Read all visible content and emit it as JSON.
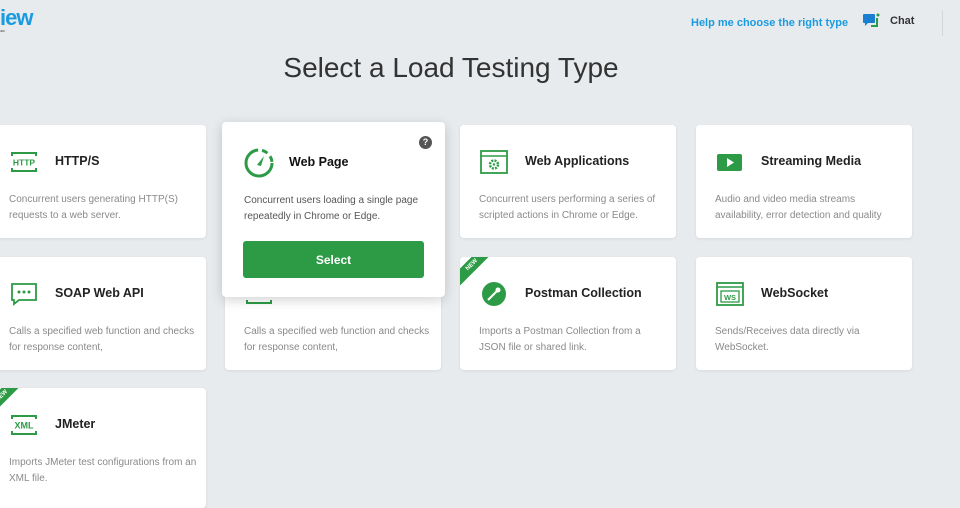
{
  "header": {
    "logo": "iew",
    "logo_sub": "ooo",
    "help_link": "Help me choose the right type",
    "chat_label": "Chat"
  },
  "title": "Select a Load Testing Type",
  "accent": "#2d9b45",
  "link_color": "#1a9be0",
  "cards": [
    {
      "title": "HTTP/S",
      "desc": "Concurrent users generating HTTP(S) requests to a web server.",
      "icon": "http-icon",
      "new": false
    },
    {
      "title": "Web Applications",
      "desc": "Concurrent users performing a series of scripted actions in Chrome or Edge.",
      "icon": "web-app-gear-icon",
      "new": false
    },
    {
      "title": "Streaming Media",
      "desc": "Audio and video media streams availability, error detection and quality",
      "icon": "play-icon",
      "new": false
    },
    {
      "title": "SOAP Web API",
      "desc": "Calls a specified web function and checks for response content,",
      "icon": "chat-bubble-icon",
      "new": false
    },
    {
      "title": "",
      "desc": "Calls a specified web function and checks for response content,",
      "icon": "api-icon",
      "new": false
    },
    {
      "title": "Postman Collection",
      "desc": "Imports a Postman Collection from a JSON file or shared link.",
      "icon": "postman-icon",
      "new": true,
      "badge": "NEW"
    },
    {
      "title": "WebSocket",
      "desc": "Sends/Receives data directly via WebSocket.",
      "icon": "websocket-icon",
      "new": false
    },
    {
      "title": "JMeter",
      "desc": "Imports JMeter test configurations from an XML file.",
      "icon": "xml-icon",
      "new": true,
      "badge": "NEW"
    }
  ],
  "hover_card": {
    "title": "Web Page",
    "desc": "Concurrent users loading a single page repeatedly in Chrome or Edge.",
    "help": "?",
    "select_label": "Select",
    "icon": "speedometer-icon"
  }
}
